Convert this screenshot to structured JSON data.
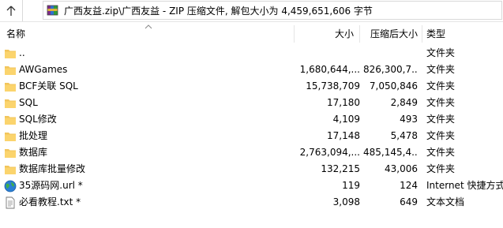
{
  "address": {
    "text": "广西友益.zip\\广西友益 - ZIP 压缩文件, 解包大小为 4,459,651,606 字节"
  },
  "columns": {
    "name": "名称",
    "size": "大小",
    "compressed": "压缩后大小",
    "type": "类型"
  },
  "files": [
    {
      "name": "..",
      "size": "",
      "compressed": "",
      "type": "文件夹",
      "icon": "folder-icon"
    },
    {
      "name": "AWGames",
      "size": "1,680,644,...",
      "compressed": "826,300,7...",
      "type": "文件夹",
      "icon": "folder-icon"
    },
    {
      "name": "BCF关联 SQL",
      "size": "15,738,709",
      "compressed": "7,050,846",
      "type": "文件夹",
      "icon": "folder-icon"
    },
    {
      "name": "SQL",
      "size": "17,180",
      "compressed": "2,849",
      "type": "文件夹",
      "icon": "folder-icon"
    },
    {
      "name": "SQL修改",
      "size": "4,109",
      "compressed": "493",
      "type": "文件夹",
      "icon": "folder-icon"
    },
    {
      "name": "批处理",
      "size": "17,148",
      "compressed": "5,478",
      "type": "文件夹",
      "icon": "folder-icon"
    },
    {
      "name": "数据库",
      "size": "2,763,094,...",
      "compressed": "485,145,4...",
      "type": "文件夹",
      "icon": "folder-icon"
    },
    {
      "name": "数据库批量修改",
      "size": "132,215",
      "compressed": "43,006",
      "type": "文件夹",
      "icon": "folder-icon"
    },
    {
      "name": "35源码网.url *",
      "size": "119",
      "compressed": "124",
      "type": "Internet 快捷方式",
      "icon": "globe-icon"
    },
    {
      "name": "必看教程.txt *",
      "size": "3,098",
      "compressed": "649",
      "type": "文本文档",
      "icon": "text-file-icon"
    }
  ]
}
